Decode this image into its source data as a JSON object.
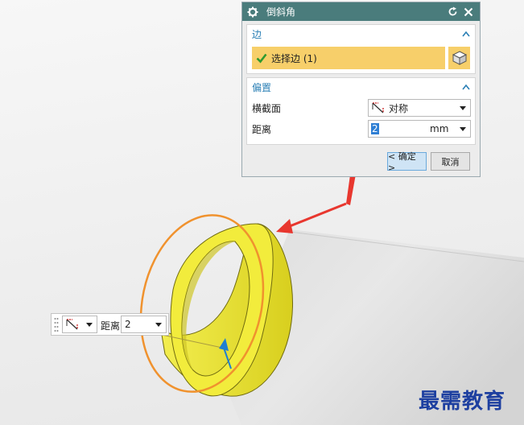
{
  "dialog": {
    "title": "倒斜角",
    "edge_group": {
      "label": "边",
      "select_edge": "选择边 (1)"
    },
    "offset_group": {
      "label": "偏置",
      "cross_section_label": "横截面",
      "cross_section_value": "对称",
      "distance_label": "距离",
      "distance_value": "2",
      "unit": "mm"
    },
    "ok_label": "< 确定 >",
    "cancel_label": "取消"
  },
  "onscreen_toolbar": {
    "distance_label": "距离",
    "distance_value": "2"
  },
  "watermark": "最需教育",
  "colors": {
    "titlebar": "#4a7c7c",
    "accent": "#2a7fb5",
    "selection": "#f7cf6a",
    "ring_fill": "#eeea3a",
    "highlight_edge": "#f0922e",
    "annotation_arrow": "#e8372f"
  },
  "icons": [
    "gear-icon",
    "reset-icon",
    "close-icon",
    "checkmark-icon",
    "cube-icon",
    "chamfer-symmetric-icon",
    "chevron-down-icon",
    "chevron-up-icon"
  ]
}
